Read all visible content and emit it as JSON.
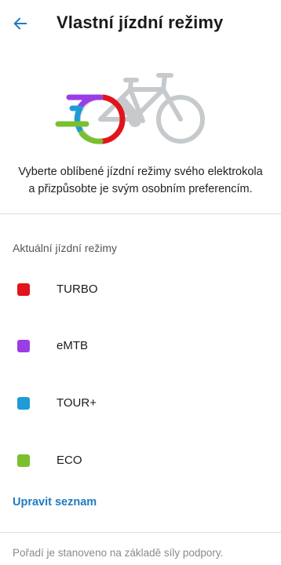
{
  "header": {
    "title": "Vlastní jízdní režimy",
    "back_icon": "arrow-left-icon"
  },
  "hero": {
    "icon": "ebike-illustration"
  },
  "intro": {
    "line1": "Vyberte oblíbené jízdní režimy svého elektrokola",
    "line2": "a přizpůsobte je svým osobním preferencím."
  },
  "section": {
    "title": "Aktuální jízdní režimy"
  },
  "modes": [
    {
      "label": "TURBO",
      "color": "#e1141c"
    },
    {
      "label": "eMTB",
      "color": "#9a3de6"
    },
    {
      "label": "TOUR+",
      "color": "#1f9bd6"
    },
    {
      "label": "ECO",
      "color": "#7ac02e"
    }
  ],
  "edit_link": "Upravit seznam",
  "footnote": "Pořadí je stanoveno na základě síly podpory.",
  "colors": {
    "accent": "#1f7bc4"
  }
}
